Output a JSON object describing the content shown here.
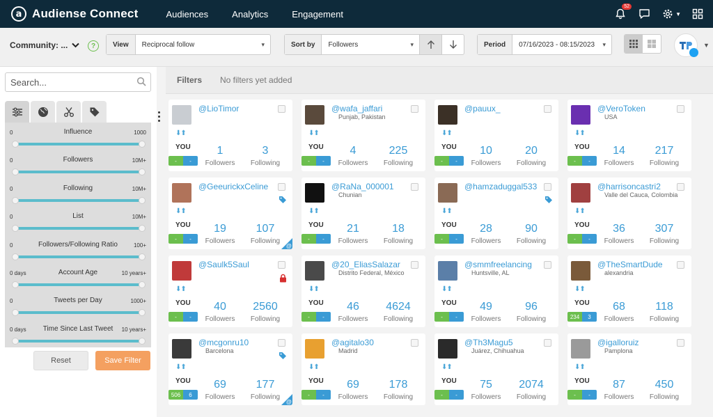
{
  "app": {
    "brand": "Audiense Connect",
    "logo_letter": "a"
  },
  "nav": [
    "Audiences",
    "Analytics",
    "Engagement"
  ],
  "top": {
    "notif_count": "52"
  },
  "toolbar": {
    "community": "Community: ...",
    "help": "?",
    "view_label": "View",
    "view_value": "Reciprocal follow",
    "sort_label": "Sort by",
    "sort_value": "Followers",
    "period_label": "Period",
    "period_value": "07/16/2023 - 08:15/2023"
  },
  "sidebar": {
    "search_placeholder": "Search...",
    "filters": [
      {
        "min": "0",
        "name": "Influence",
        "max": "1000"
      },
      {
        "min": "0",
        "name": "Followers",
        "max": "10M+"
      },
      {
        "min": "0",
        "name": "Following",
        "max": "10M+"
      },
      {
        "min": "0",
        "name": "List",
        "max": "10M+"
      },
      {
        "min": "0",
        "name": "Followers/Following Ratio",
        "max": "100+"
      },
      {
        "min": "0 days",
        "name": "Account Age",
        "max": "10 years+"
      },
      {
        "min": "0",
        "name": "Tweets per Day",
        "max": "1000+"
      },
      {
        "min": "0 days",
        "name": "Time Since Last Tweet",
        "max": "10 years+"
      }
    ],
    "reset": "Reset",
    "save": "Save Filter"
  },
  "filters_bar": {
    "label": "Filters",
    "empty": "No filters yet added"
  },
  "card_labels": {
    "you": "YOU",
    "followers": "Followers",
    "following": "Following"
  },
  "colors": {
    "accent": "#3a9bd5",
    "green": "#6cbf4e",
    "orange": "#f4a060",
    "topbar": "#0e2a3a"
  },
  "cards": [
    {
      "handle": "@LioTimor",
      "loc": "",
      "followers": "1",
      "following": "3",
      "pill": [
        "-",
        "-"
      ],
      "tag": "",
      "corner": false,
      "pic": "#c9cdd2"
    },
    {
      "handle": "@wafa_jaffari",
      "loc": "Punjab, Pakistan",
      "followers": "4",
      "following": "225",
      "pill": [
        "-",
        "-"
      ],
      "tag": "",
      "corner": false,
      "pic": "#5a4a3c"
    },
    {
      "handle": "@pauux_",
      "loc": "",
      "followers": "10",
      "following": "20",
      "pill": [
        "-",
        "-"
      ],
      "tag": "",
      "corner": false,
      "pic": "#3b3026"
    },
    {
      "handle": "@VeroToken",
      "loc": "USA",
      "followers": "14",
      "following": "217",
      "pill": [
        "-",
        "-"
      ],
      "tag": "",
      "corner": false,
      "pic": "#6a2fb0"
    },
    {
      "handle": "@GeeurickxCeline",
      "loc": "",
      "followers": "19",
      "following": "107",
      "pill": [
        "-",
        "-"
      ],
      "tag": "blue",
      "corner": true,
      "pic": "#b0735a"
    },
    {
      "handle": "@RaNa_000001",
      "loc": "Chunian",
      "followers": "21",
      "following": "18",
      "pill": [
        "-",
        "-"
      ],
      "tag": "",
      "corner": false,
      "pic": "#111111"
    },
    {
      "handle": "@hamzaduggal533",
      "loc": "",
      "followers": "28",
      "following": "90",
      "pill": [
        "-",
        "-"
      ],
      "tag": "blue",
      "corner": false,
      "pic": "#8a6a55"
    },
    {
      "handle": "@harrisoncastri2",
      "loc": "Valle del Cauca, Colombia",
      "followers": "36",
      "following": "307",
      "pill": [
        "-",
        "-"
      ],
      "tag": "",
      "corner": false,
      "pic": "#a04040"
    },
    {
      "handle": "@Saulk5Saul",
      "loc": "",
      "followers": "40",
      "following": "2560",
      "pill": [
        "-",
        "-"
      ],
      "tag": "lock",
      "corner": false,
      "pic": "#c03a3a"
    },
    {
      "handle": "@20_EliasSalazar",
      "loc": "Distrito Federal, México",
      "followers": "46",
      "following": "4624",
      "pill": [
        "-",
        "-"
      ],
      "tag": "",
      "corner": false,
      "pic": "#4a4a4a"
    },
    {
      "handle": "@smmfreelancing",
      "loc": "Huntsville, AL",
      "followers": "49",
      "following": "96",
      "pill": [
        "-",
        "-"
      ],
      "tag": "",
      "corner": false,
      "pic": "#5b7fa8"
    },
    {
      "handle": "@TheSmartDude",
      "loc": "alexandria",
      "followers": "68",
      "following": "118",
      "pill": [
        "234",
        "3"
      ],
      "tag": "",
      "corner": false,
      "pic": "#7a5a3a"
    },
    {
      "handle": "@mcgonru10",
      "loc": "Barcelona",
      "followers": "69",
      "following": "177",
      "pill": [
        "506",
        "6"
      ],
      "tag": "blue",
      "corner": true,
      "pic": "#3a3a3a"
    },
    {
      "handle": "@agitalo30",
      "loc": "Madrid",
      "followers": "69",
      "following": "178",
      "pill": [
        "-",
        "-"
      ],
      "tag": "",
      "corner": false,
      "pic": "#e8a030"
    },
    {
      "handle": "@Th3Magu5",
      "loc": "Juárez, Chihuahua",
      "followers": "75",
      "following": "2074",
      "pill": [
        "-",
        "-"
      ],
      "tag": "",
      "corner": false,
      "pic": "#2a2a2a"
    },
    {
      "handle": "@igalloruiz",
      "loc": "Pamplona",
      "followers": "87",
      "following": "450",
      "pill": [
        "-",
        "-"
      ],
      "tag": "",
      "corner": false,
      "pic": "#9a9a9a"
    }
  ]
}
